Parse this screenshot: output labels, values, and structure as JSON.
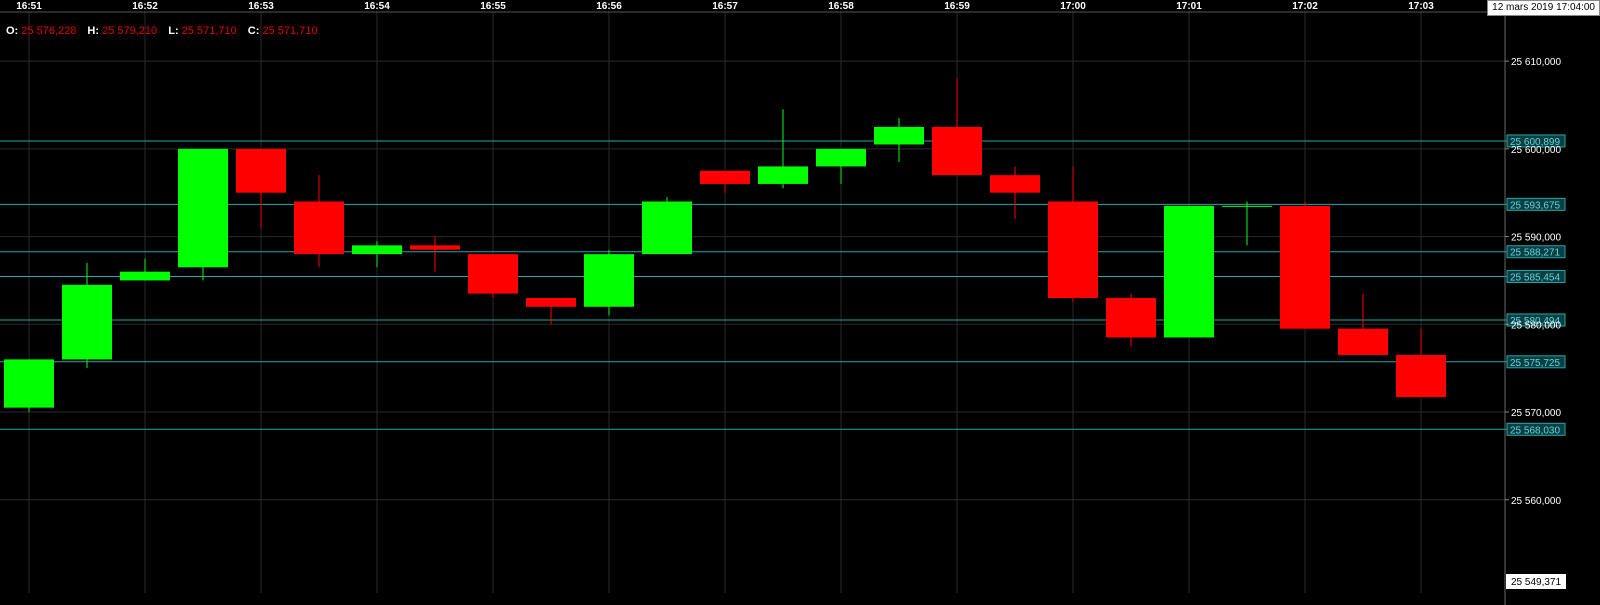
{
  "ohlc": {
    "open_label": "O:",
    "open": "25 576,228",
    "high_label": "H:",
    "high": "25 579,210",
    "low_label": "L:",
    "low": "25 571,710",
    "close_label": "C:",
    "close": "25 571,710"
  },
  "timestamp": "12 mars 2019 17:04:00",
  "colors": {
    "up": "#00ff00",
    "down": "#ff0000",
    "level": "#1fa8a8",
    "grid": "#2a2a2a",
    "axis_text": "#ffffff"
  },
  "chart_data": {
    "type": "candlestick",
    "time_labels": [
      "16:51",
      "16:52",
      "16:53",
      "16:54",
      "16:55",
      "16:56",
      "16:57",
      "16:58",
      "16:59",
      "17:00",
      "17:01",
      "17:02",
      "17:03"
    ],
    "y_ticks": [
      "25 610,000",
      "25 600,000",
      "25 590,000",
      "25 580,000",
      "25 570,000",
      "25 560,000"
    ],
    "y_tick_values": [
      25610,
      25600,
      25590,
      25580,
      25570,
      25560
    ],
    "y_min_label": "25 549,371",
    "ylim": [
      25549.371,
      25615.6
    ],
    "levels": [
      {
        "value": 25600.899,
        "label": "25 600,899"
      },
      {
        "value": 25593.675,
        "label": "25 593,675"
      },
      {
        "value": 25588.271,
        "label": "25 588,271"
      },
      {
        "value": 25585.454,
        "label": "25 585,454"
      },
      {
        "value": 25580.494,
        "label": "25 580,494"
      },
      {
        "value": 25575.725,
        "label": "25 575,725"
      },
      {
        "value": 25568.03,
        "label": "25 568,030"
      }
    ],
    "candles": [
      {
        "o": 25570.5,
        "h": 25576.0,
        "l": 25570.0,
        "c": 25576.0
      },
      {
        "o": 25576.0,
        "h": 25587.0,
        "l": 25575.0,
        "c": 25584.5
      },
      {
        "o": 25585.0,
        "h": 25587.5,
        "l": 25585.0,
        "c": 25586.0
      },
      {
        "o": 25586.5,
        "h": 25599.5,
        "l": 25585.0,
        "c": 25600.0
      },
      {
        "o": 25600.0,
        "h": 25600.0,
        "l": 25591.0,
        "c": 25595.0
      },
      {
        "o": 25594.0,
        "h": 25597.0,
        "l": 25586.5,
        "c": 25588.0
      },
      {
        "o": 25588.0,
        "h": 25589.5,
        "l": 25586.5,
        "c": 25589.0
      },
      {
        "o": 25589.0,
        "h": 25590.0,
        "l": 25586.0,
        "c": 25588.5
      },
      {
        "o": 25588.0,
        "h": 25588.0,
        "l": 25583.0,
        "c": 25583.5
      },
      {
        "o": 25583.0,
        "h": 25583.0,
        "l": 25580.0,
        "c": 25582.0
      },
      {
        "o": 25582.0,
        "h": 25588.5,
        "l": 25581.0,
        "c": 25588.0
      },
      {
        "o": 25588.0,
        "h": 25594.5,
        "l": 25588.0,
        "c": 25594.0
      },
      {
        "o": 25597.5,
        "h": 25597.5,
        "l": 25595.0,
        "c": 25596.0
      },
      {
        "o": 25596.0,
        "h": 25604.5,
        "l": 25595.5,
        "c": 25598.0
      },
      {
        "o": 25598.0,
        "h": 25600.0,
        "l": 25596.0,
        "c": 25600.0
      },
      {
        "o": 25600.5,
        "h": 25603.5,
        "l": 25598.5,
        "c": 25602.5
      },
      {
        "o": 25602.5,
        "h": 25608.0,
        "l": 25597.5,
        "c": 25597.0
      },
      {
        "o": 25597.0,
        "h": 25598.0,
        "l": 25592.0,
        "c": 25595.0
      },
      {
        "o": 25594.0,
        "h": 25598.0,
        "l": 25582.5,
        "c": 25583.0
      },
      {
        "o": 25583.0,
        "h": 25583.5,
        "l": 25577.5,
        "c": 25578.5
      },
      {
        "o": 25578.5,
        "h": 25593.5,
        "l": 25578.5,
        "c": 25593.5
      },
      {
        "o": 25593.5,
        "h": 25594.0,
        "l": 25589.0,
        "c": 25593.5
      },
      {
        "o": 25593.5,
        "h": 25594.0,
        "l": 25579.5,
        "c": 25579.5
      },
      {
        "o": 25579.5,
        "h": 25583.5,
        "l": 25576.5,
        "c": 25576.5
      },
      {
        "o": 25576.5,
        "h": 25579.5,
        "l": 25571.7,
        "c": 25571.7
      }
    ]
  }
}
